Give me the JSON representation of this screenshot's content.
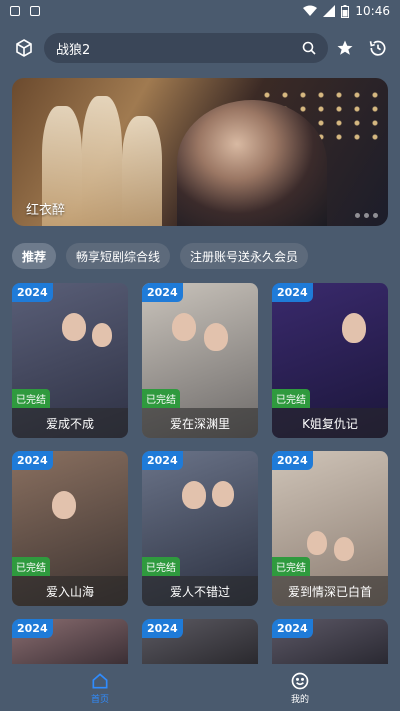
{
  "status": {
    "time": "10:46"
  },
  "search": {
    "value": "战狼2"
  },
  "banner": {
    "title": "红衣醉"
  },
  "chips": [
    {
      "label": "推荐"
    },
    {
      "label": "畅享短剧综合线"
    },
    {
      "label": "注册账号送永久会员"
    }
  ],
  "cards": [
    {
      "year": "2024",
      "status": "已完结",
      "title": "爱成不成",
      "bg": "#3b3f52"
    },
    {
      "year": "2024",
      "status": "已完结",
      "title": "爱在深渊里",
      "bg": "#8d8a85"
    },
    {
      "year": "2024",
      "status": "已完结",
      "title": "K姐复仇记",
      "bg": "#2a2353"
    },
    {
      "year": "2024",
      "status": "已完结",
      "title": "爱入山海",
      "bg": "#5b4d45"
    },
    {
      "year": "2024",
      "status": "已完结",
      "title": "爱人不错过",
      "bg": "#3b4255"
    },
    {
      "year": "2024",
      "status": "已完结",
      "title": "爱到情深已白首",
      "bg": "#a9968a"
    },
    {
      "year": "2024",
      "status": "",
      "title": "",
      "bg": "#5a4f55"
    },
    {
      "year": "2024",
      "status": "",
      "title": "",
      "bg": "#3c3a40"
    },
    {
      "year": "2024",
      "status": "",
      "title": "",
      "bg": "#3d3b45"
    }
  ],
  "nav": {
    "home_label": "首页",
    "mine_label": "我的"
  },
  "colors": {
    "accent": "#2f8cff",
    "year_badge": "#1f7bd8",
    "done_badge": "#2f9a3e"
  }
}
